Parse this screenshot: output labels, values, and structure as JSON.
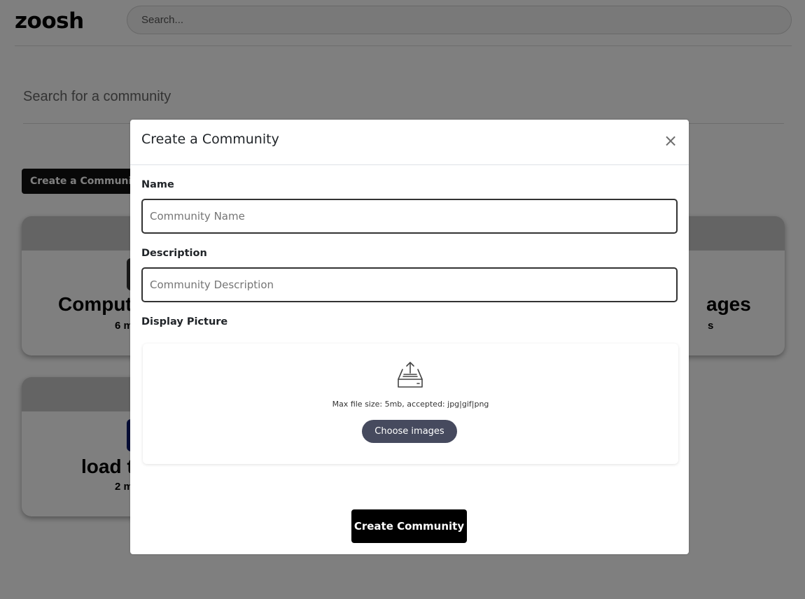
{
  "header": {
    "logo": "zoosh",
    "search_placeholder": "Search..."
  },
  "page": {
    "community_search_placeholder": "Search for a community",
    "create_button_label": "Create a Communit"
  },
  "cards": [
    {
      "title": "Comput",
      "title_right": "ages",
      "members": "6 m",
      "members_right": "s"
    },
    {
      "title": "load t",
      "members": "2 m"
    }
  ],
  "modal": {
    "title": "Create a Community",
    "close_label": "×",
    "name_label": "Name",
    "name_placeholder": "Community Name",
    "description_label": "Description",
    "description_placeholder": "Community Description",
    "picture_label": "Display Picture",
    "upload_icon": "inbox-upload-icon",
    "file_hint": "Max file size: 5mb, accepted: jpg|gif|png",
    "choose_button": "Choose images",
    "submit_button": "Create Community"
  },
  "colors": {
    "overlay": "rgba(0,0,0,0.5)",
    "choose_button_bg": "#464a5e",
    "submit_button_bg": "#000000"
  }
}
